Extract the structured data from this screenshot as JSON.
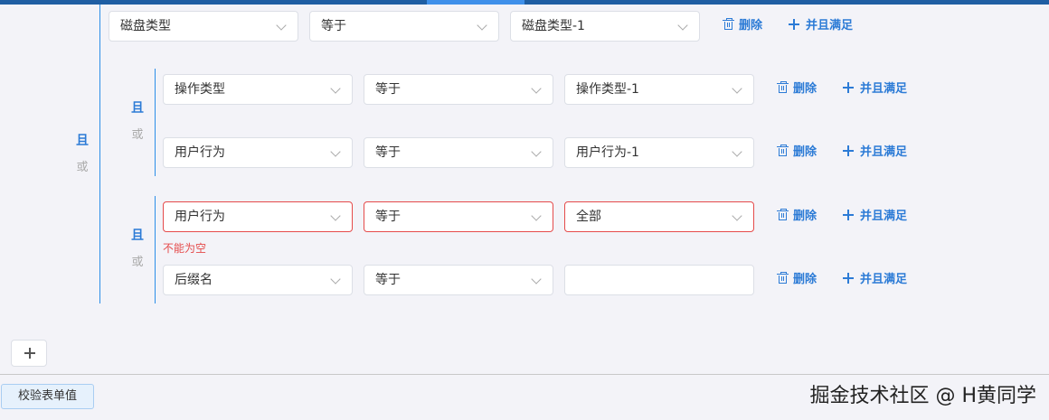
{
  "groups": {
    "outer": {
      "and_label": "且",
      "or_label": "或"
    },
    "inner1": {
      "and_label": "且",
      "or_label": "或"
    },
    "inner2": {
      "and_label": "且",
      "or_label": "或"
    }
  },
  "rows": [
    {
      "field": "磁盘类型",
      "operator": "等于",
      "value": "磁盘类型-1",
      "delete_label": "删除",
      "and_label": "并且满足"
    },
    {
      "field": "操作类型",
      "operator": "等于",
      "value": "操作类型-1",
      "delete_label": "删除",
      "and_label": "并且满足"
    },
    {
      "field": "用户行为",
      "operator": "等于",
      "value": "用户行为-1",
      "delete_label": "删除",
      "and_label": "并且满足"
    },
    {
      "field": "用户行为",
      "operator": "等于",
      "value": "全部",
      "delete_label": "删除",
      "and_label": "并且满足",
      "error": "不能为空"
    },
    {
      "field": "后缀名",
      "operator": "等于",
      "value": "",
      "delete_label": "删除",
      "and_label": "并且满足"
    }
  ],
  "footer": {
    "validate_label": "校验表单值"
  },
  "watermark": "掘金技术社区 @ H黄同学",
  "colors": {
    "accent": "#2c7bd6",
    "error": "#e54b4b",
    "topbar": "#1f5ea3"
  }
}
